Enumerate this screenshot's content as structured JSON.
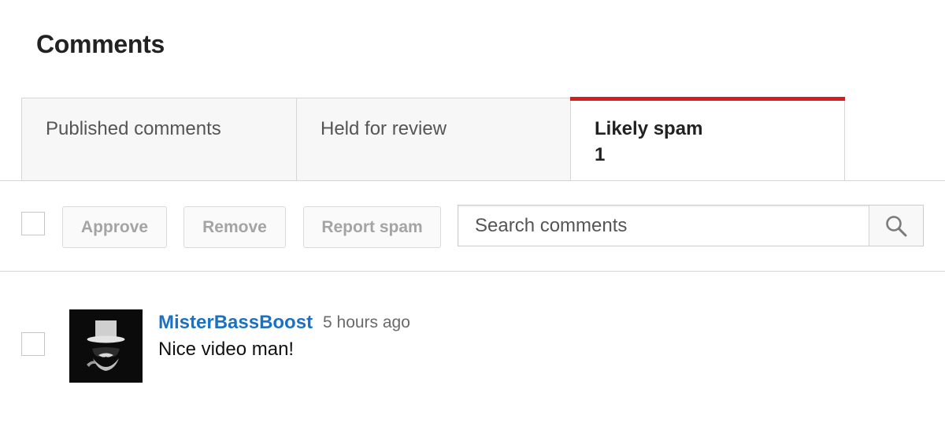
{
  "page": {
    "title": "Comments"
  },
  "tabs": [
    {
      "label": "Published comments",
      "active": false
    },
    {
      "label": "Held for review",
      "active": false
    },
    {
      "label": "Likely spam",
      "count": "1",
      "active": true
    }
  ],
  "toolbar": {
    "approve_label": "Approve",
    "remove_label": "Remove",
    "report_spam_label": "Report spam"
  },
  "search": {
    "placeholder": "Search comments",
    "value": "",
    "icon": "search-icon"
  },
  "comments": [
    {
      "author": "MisterBassBoost",
      "time": "5 hours ago",
      "text": "Nice video man!",
      "avatar_icon": "top-hat-mustache-avatar"
    }
  ],
  "colors": {
    "active_tab_accent": "#d61e1e",
    "author_link": "#1b72c4",
    "tab_background": "#f7f7f7",
    "border": "#d6d6d6"
  }
}
